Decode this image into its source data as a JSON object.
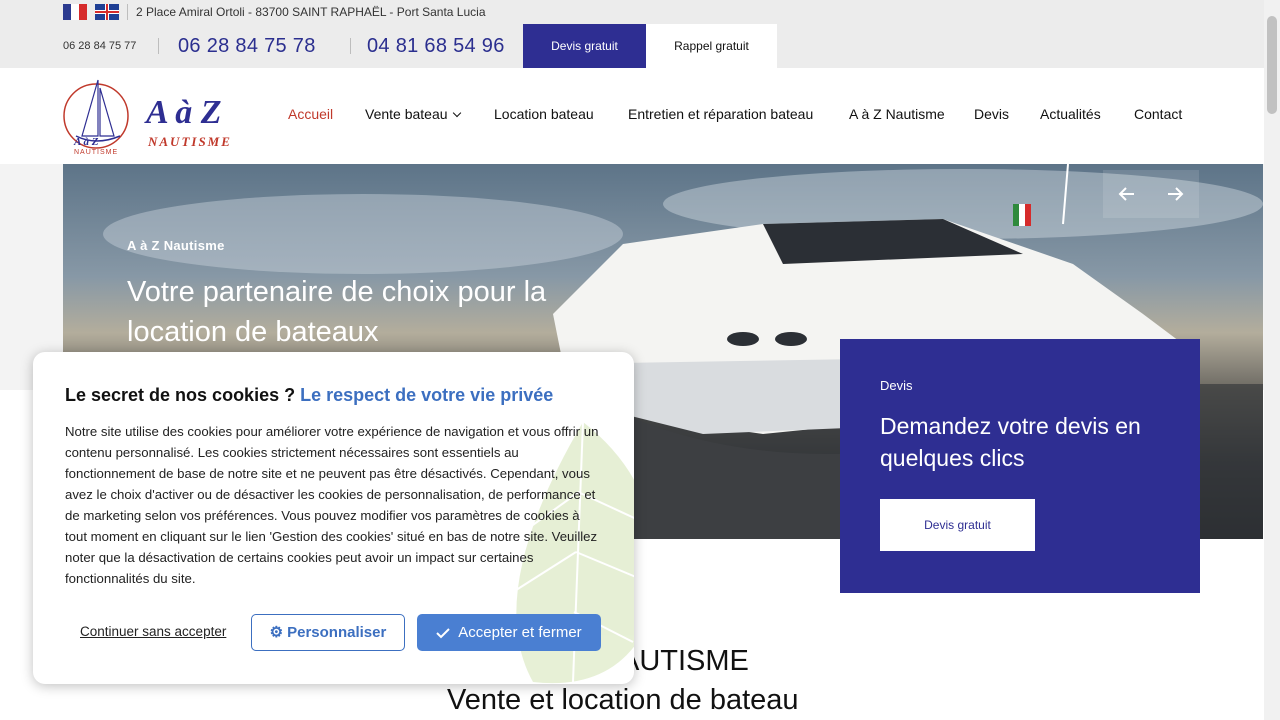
{
  "topbar": {
    "address": "2 Place Amiral Ortoli - 83700 SAINT RAPHAËL - Port Santa Lucia",
    "phone_small": "06 28 84 75 77",
    "phone_1": "06 28 84 75 78",
    "phone_2": "04 81 68 54 96",
    "devis_button": "Devis gratuit",
    "rappel_button": "Rappel gratuit"
  },
  "logo": {
    "text_main": "A à Z",
    "text_sub": "NAUTISME",
    "badge_top": "A à Z",
    "badge_sub": "NAUTISME"
  },
  "nav": {
    "items": [
      {
        "label": "Accueil"
      },
      {
        "label": "Vente bateau"
      },
      {
        "label": "Location bateau"
      },
      {
        "label": "Entretien et réparation bateau"
      },
      {
        "label": "A à Z Nautisme"
      },
      {
        "label": "Devis"
      },
      {
        "label": "Actualités"
      },
      {
        "label": "Contact"
      }
    ]
  },
  "hero": {
    "eyebrow": "A à Z Nautisme",
    "title": "Votre partenaire de choix pour la location de bateaux",
    "prev_icon": "arrow-left-icon",
    "next_icon": "arrow-right-icon"
  },
  "devis_card": {
    "eyebrow": "Devis",
    "title": "Demandez votre devis en quelques clics",
    "button": "Devis gratuit"
  },
  "section": {
    "line1": "AUTISME",
    "line2": "Vente et location de bateau"
  },
  "cookie": {
    "title_plain": "Le secret de nos cookies ?",
    "title_accent": "Le respect de votre vie privée",
    "body": "Notre site utilise des cookies pour améliorer votre expérience de navigation et vous offrir un contenu personnalisé. Les cookies strictement nécessaires sont essentiels au fonctionnement de base de notre site et ne peuvent pas être désactivés. Cependant, vous avez le choix d'activer ou de désactiver les cookies de personnalisation, de performance et de marketing selon vos préférences. Vous pouvez modifier vos paramètres de cookies à tout moment en cliquant sur le lien 'Gestion des cookies' situé en bas de notre site. Veuillez noter que la désactivation de certains cookies peut avoir un impact sur certaines fonctionnalités du site.",
    "continue": "Continuer sans accepter",
    "customize": "Personnaliser",
    "accept": "Accepter et fermer"
  },
  "colors": {
    "brand_blue": "#2e2e92",
    "accent_red": "#c0392b",
    "cookie_blue": "#4a7fd2"
  }
}
